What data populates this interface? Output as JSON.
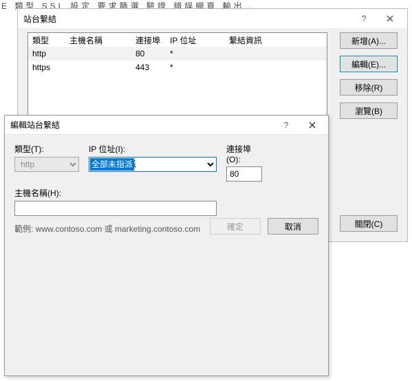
{
  "bg_menu_text": "E  類型   SSL 設定   要求篩選   驗證   錯誤網頁   輸出…",
  "site_bindings": {
    "title": "站台繫結",
    "help_symbol": "?",
    "columns": {
      "type": "類型",
      "host": "主機名稱",
      "port": "連接埠",
      "ip": "IP 位址",
      "info": "繫結資訊"
    },
    "rows": [
      {
        "type": "http",
        "host": "",
        "port": "80",
        "ip": "*",
        "info": ""
      },
      {
        "type": "https",
        "host": "",
        "port": "443",
        "ip": "*",
        "info": ""
      }
    ],
    "buttons": {
      "add": "新增(A)...",
      "edit": "編輯(E)...",
      "remove": "移除(R)",
      "browse": "瀏覽(B)",
      "close": "關閉(C)"
    }
  },
  "edit_binding": {
    "title": "編輯站台繫結",
    "help_symbol": "?",
    "labels": {
      "type": "類型(T):",
      "ip": "IP 位址(I):",
      "port": "連接埠(O):",
      "host": "主機名稱(H):"
    },
    "values": {
      "type": "http",
      "ip": "全部未指派",
      "port": "80",
      "host": ""
    },
    "example": "範例: www.contoso.com 或 marketing.contoso.com",
    "ok": "確定",
    "cancel": "取消"
  }
}
